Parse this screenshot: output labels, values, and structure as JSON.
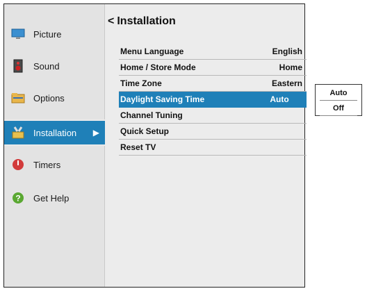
{
  "sidebar": {
    "items": [
      {
        "label": "Picture",
        "icon": "monitor-icon"
      },
      {
        "label": "Sound",
        "icon": "speaker-icon"
      },
      {
        "label": "Options",
        "icon": "folder-icon"
      },
      {
        "label": "Installation",
        "icon": "tools-icon",
        "active": true
      },
      {
        "label": "Timers",
        "icon": "timer-icon"
      },
      {
        "label": "Get Help",
        "icon": "help-icon"
      }
    ],
    "active_arrow": "▶"
  },
  "page": {
    "back_glyph": "<",
    "title": "Installation"
  },
  "menu": {
    "rows": [
      {
        "label": "Menu Language",
        "value": "English"
      },
      {
        "label": "Home / Store Mode",
        "value": "Home"
      },
      {
        "label": "Time Zone",
        "value": "Eastern"
      },
      {
        "label": "Daylight Saving Time",
        "value": "Auto"
      },
      {
        "label": "Channel Tuning",
        "value": ""
      },
      {
        "label": "Quick Setup",
        "value": ""
      },
      {
        "label": "Reset TV",
        "value": ""
      }
    ]
  },
  "popup": {
    "options": [
      "Auto",
      "Off"
    ]
  },
  "colors": {
    "highlight": "#1f80b8",
    "sidebar_bg": "#e3e3e3",
    "main_bg": "#ececec"
  }
}
